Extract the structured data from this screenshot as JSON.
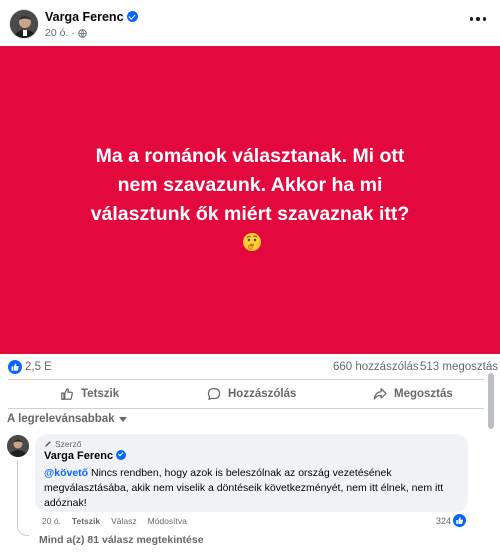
{
  "post": {
    "author": "Varga Ferenc",
    "time": "20 ó.",
    "meta_separator": "·",
    "image_text": "Ma a románok választanak. Mi ott nem szavazunk. Akkor ha mi választunk ők miért szavaznak itt?",
    "image_background": "#e3093f"
  },
  "icons": {
    "verified": "verified-badge-icon",
    "privacy": "globe-icon",
    "more": "more-options-icon",
    "emoji": "thinking-face-emoji",
    "like": "like-icon",
    "comment": "comment-icon",
    "share": "share-icon",
    "author_tag": "pencil-icon"
  },
  "stats": {
    "reactions": "2,5 E",
    "comments": "660 hozzászólás",
    "shares": "513 megosztás"
  },
  "actions": {
    "like": "Tetszik",
    "comment": "Hozzászólás",
    "share": "Megosztás"
  },
  "comments_section": {
    "sort_label": "A legrelevánsabbak",
    "comment": {
      "author_tag": "Szerző",
      "author": "Varga Ferenc",
      "mention": "@követő",
      "text": " Nincs rendben, hogy azok is beleszólnak az ország vezetésének megválasztásába, akik nem viselik a döntéseik következményét, nem itt élnek, nem itt adóznak!",
      "time": "20 ó.",
      "like_action": "Tetszik",
      "reply_action": "Válasz",
      "edited": "Módosítva",
      "reaction_count": "324"
    },
    "view_replies": "Mind a(z) 81 válasz megtekintése"
  },
  "colors": {
    "accent": "#0866ff",
    "secondary_text": "#65676b",
    "bubble": "#f0f2f5"
  }
}
